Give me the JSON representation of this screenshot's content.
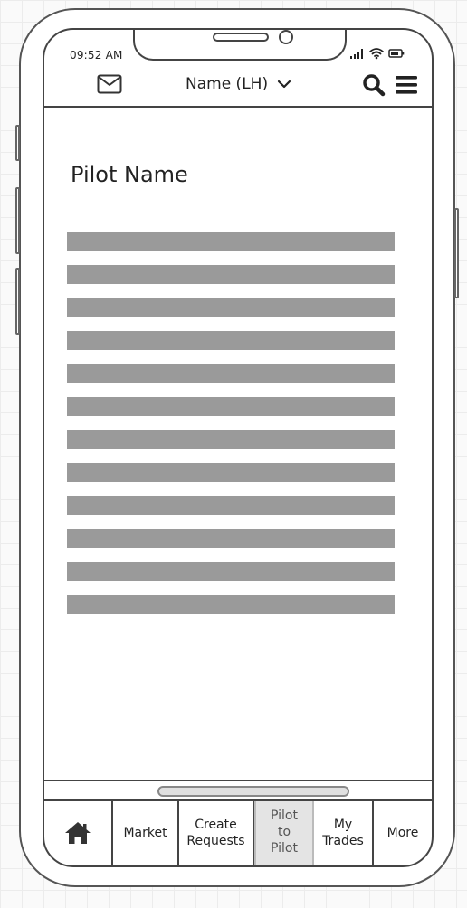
{
  "status_bar": {
    "time": "09:52 AM"
  },
  "header": {
    "title": "Name (LH)",
    "mail_icon": "mail-icon",
    "dropdown_icon": "chevron-down-icon",
    "search_icon": "search-icon",
    "menu_icon": "hamburger-menu-icon"
  },
  "main": {
    "page_title": "Pilot Name",
    "placeholder_lines": 12
  },
  "tabbar": {
    "items": [
      {
        "id": "home",
        "label": "",
        "icon": "home-icon"
      },
      {
        "id": "market",
        "label": "Market"
      },
      {
        "id": "create-requests",
        "label": "Create\nRequests"
      },
      {
        "id": "pilot-to-pilot",
        "label": "Pilot\nto\nPilot",
        "active": true
      },
      {
        "id": "my-trades",
        "label": "My\nTrades"
      },
      {
        "id": "more",
        "label": "More"
      }
    ]
  },
  "colors": {
    "outline": "#444444",
    "placeholder_bar": "#9a9a9a",
    "active_tab_bg": "#e4e4e4"
  }
}
